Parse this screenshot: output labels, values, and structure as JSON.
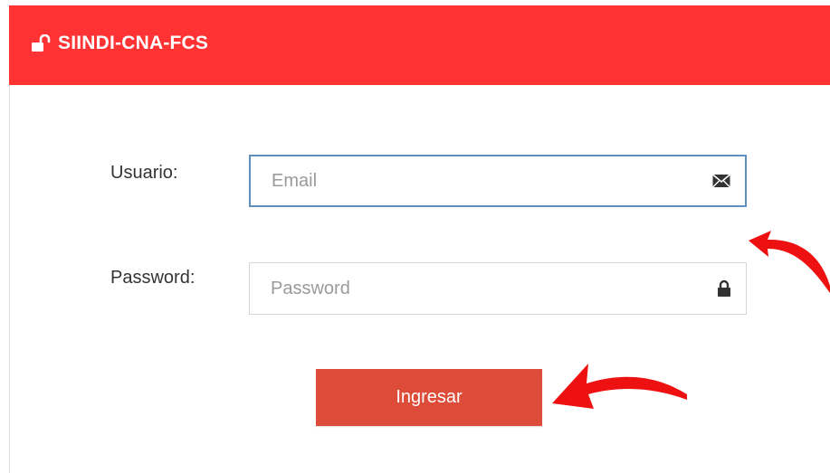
{
  "header": {
    "title": "SIINDI-CNA-FCS",
    "icon": "unlock-icon",
    "bg_color": "#ff3333"
  },
  "form": {
    "usuario_label": "Usuario:",
    "email_placeholder": "Email",
    "email_value": "",
    "email_icon": "envelope-icon",
    "password_label": "Password:",
    "password_placeholder": "Password",
    "password_value": "",
    "password_icon": "lock-icon",
    "submit_label": "Ingresar",
    "submit_color": "#dd4b39",
    "focus_border_color": "#5d8fc2"
  },
  "annotations": {
    "arrow_color": "#ee1111"
  }
}
